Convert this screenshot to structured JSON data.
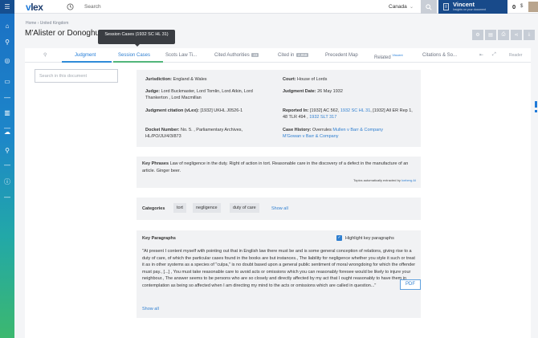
{
  "topbar": {
    "logo_v": "v",
    "logo_rest": "lex",
    "search_label": "Search",
    "country": "Canada",
    "user_name": "Vincent",
    "user_subtitle": "Insights on your document",
    "credit": "0"
  },
  "page": {
    "breadcrumb": "Home › United Kingdom",
    "title": "M'Alister or Donoghue",
    "tooltip": "Session Cases (1932 SC HL 31)"
  },
  "tabs": {
    "judgment": "Judgment",
    "session_cases": "Session Cases",
    "scots_law": "Scots Law Ti...",
    "cited_authorities": "Cited Authorities",
    "cited_authorities_count": "23",
    "cited_in": "Cited in",
    "cited_in_count": "2,958",
    "precedent_map": "Precedent Map",
    "related": "Related",
    "related_sup": "Vincent",
    "citations": "Citations & So...",
    "reader": "Reader"
  },
  "doc_search": {
    "placeholder": "Search in this document"
  },
  "meta": {
    "jurisdiction_label": "Jurisdiction:",
    "jurisdiction": "England & Wales",
    "court_label": "Court:",
    "court": "House of Lords",
    "judge_label": "Judge:",
    "judge": "Lord Buckmaster, Lord Tomlin, Lord Atkin, Lord Thankerton , Lord Macmillan",
    "judgment_date_label": "Judgment Date:",
    "judgment_date": "26 May 1932",
    "citation_label": "Judgment citation (vLex):",
    "citation": "[1932] UKHL J0526-1",
    "reported_label": "Reported In:",
    "reported_plain1": "[1932] AC 562,",
    "reported_link1": "1932 SC HL 31",
    "reported_plain2": ", [1932] All ER Rep 1, 48 TLR 494 ,",
    "reported_link2": "1932 SLT 317",
    "docket_label": "Docket Number:",
    "docket": "No. 5. , Parliamentary Archives, HL/PO/JU/4/3/873",
    "history_label": "Case History:",
    "history_plain": "Overrules",
    "history_link1": "Mullen v Barr & Company",
    "history_link2": "M'Gowan v Barr & Company"
  },
  "key_phrases": {
    "label": "Key Phrases",
    "text": "Law of negligence in the duty. Right of action in tort. Reasonable care in the discovery of a defect in the manufacture of an article. Ginger beer.",
    "note_prefix": "Topics automatically extracted by",
    "note_link": "Iceberg AI"
  },
  "categories": {
    "label": "Categories",
    "chips": [
      "tort",
      "negligence",
      "duty of care"
    ],
    "show_all": "Show all"
  },
  "key_paragraphs": {
    "title": "Key Paragraphs",
    "highlight_label": "Highlight key paragraphs",
    "highlight_checked": true,
    "text": "\"At present I content myself with pointing out that in English law there must be and is some general conception of relations, giving rise to a duty of care, of which the particular cases found in the books are but instances., The liability for negligence whether you style it such or treat it as in other systems as a species of \"culpa,\" is no doubt based upon a general public sentiment of moral wrongdoing for which the offender must pay., [...] , You must take reasonable care to avoid acts or omissions which you can reasonably foresee would be likely to injure your neighbour., The answer seems to be persons who are so closely and directly affected by my act that I ought reasonably to have them in contemplation as being so affected when I am directing my mind to the acts or omissions which are called in question...\"",
    "show_all": "Show all"
  },
  "pdf_button": "PDF",
  "colors": {
    "accent": "#1f7ad8",
    "user_panel": "#184a8a",
    "tab_green": "#52b67a"
  }
}
